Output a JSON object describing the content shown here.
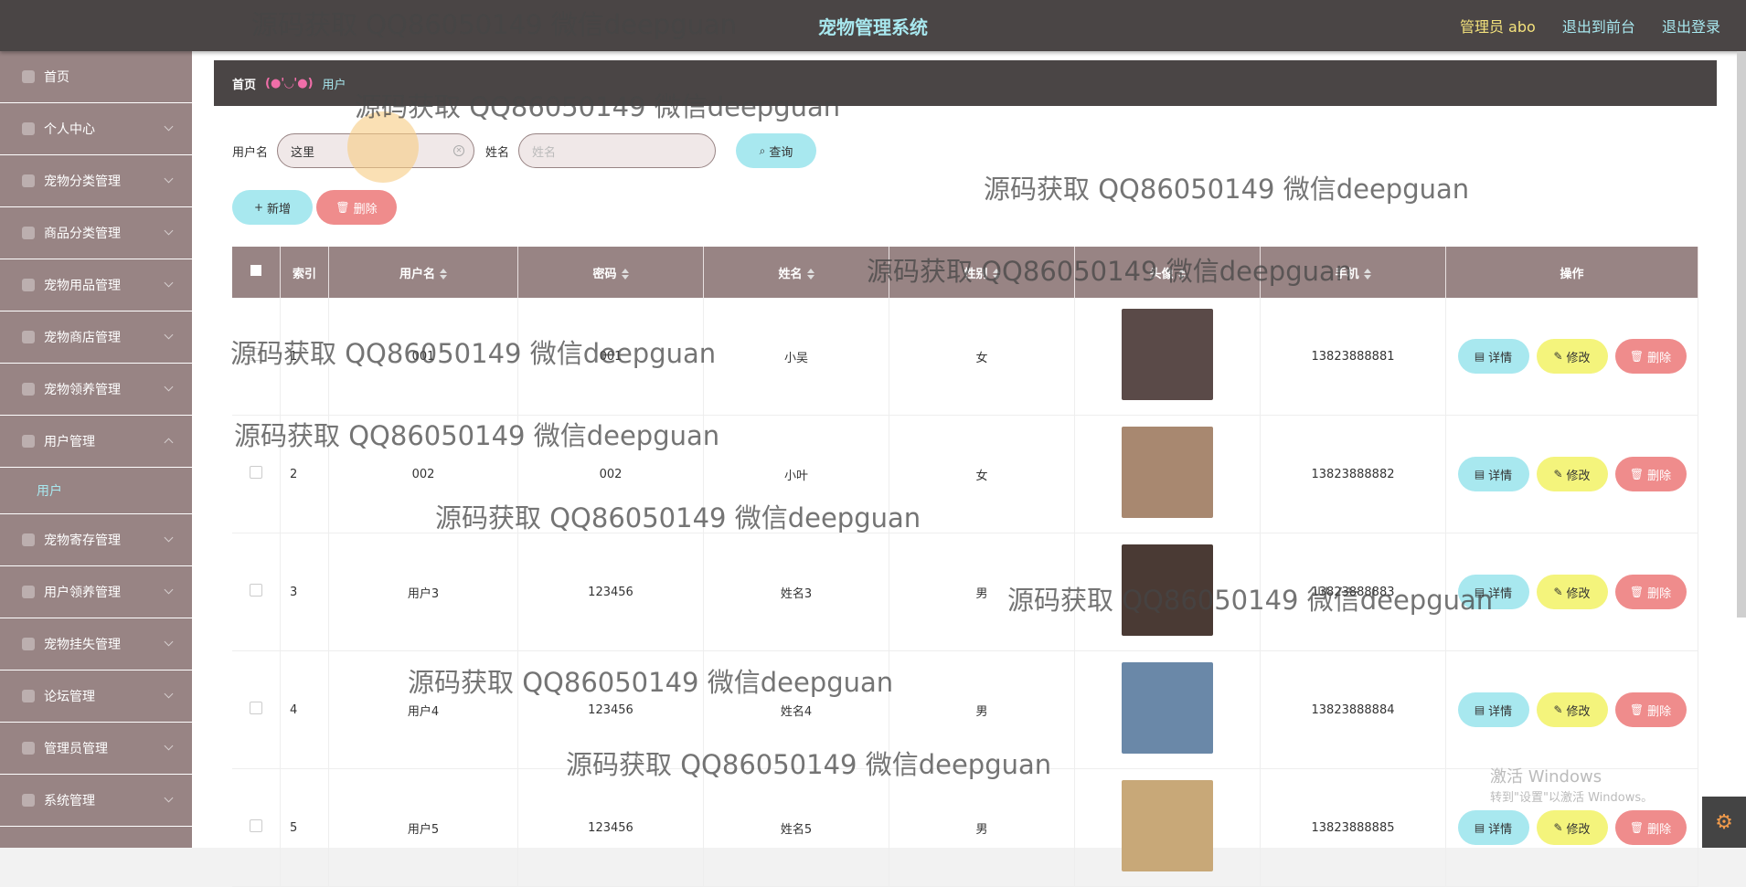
{
  "header": {
    "title": "宠物管理系统",
    "admin": "管理员 abo",
    "to_front": "退出到前台",
    "logout": "退出登录"
  },
  "sidebar": {
    "items": [
      {
        "label": "首页",
        "icon": "home-icon"
      },
      {
        "label": "个人中心",
        "icon": "user-icon"
      },
      {
        "label": "宠物分类管理",
        "icon": "list-icon"
      },
      {
        "label": "商品分类管理",
        "icon": "grid-icon"
      },
      {
        "label": "宠物用品管理",
        "icon": "list-icon"
      },
      {
        "label": "宠物商店管理",
        "icon": "list-icon"
      },
      {
        "label": "宠物领养管理",
        "icon": "list-icon"
      },
      {
        "label": "用户管理",
        "icon": "user-icon"
      },
      {
        "label": "宠物寄存管理",
        "icon": "flag-icon"
      },
      {
        "label": "用户领养管理",
        "icon": "circle-icon"
      },
      {
        "label": "宠物挂失管理",
        "icon": "user-icon"
      },
      {
        "label": "论坛管理",
        "icon": "list-icon"
      },
      {
        "label": "管理员管理",
        "icon": "user-icon"
      },
      {
        "label": "系统管理",
        "icon": "list-icon"
      }
    ],
    "sub_item": "用户"
  },
  "breadcrumb": {
    "home": "首页",
    "face": "(●'◡'●)",
    "current": "用户"
  },
  "search": {
    "username_label": "用户名",
    "username_value": "这里",
    "name_label": "姓名",
    "name_placeholder": "姓名",
    "query_button": "查询"
  },
  "actions": {
    "add": "新增",
    "delete": "删除"
  },
  "table": {
    "columns": [
      "索引",
      "用户名",
      "密码",
      "姓名",
      "性别",
      "头像",
      "手机",
      "操作"
    ],
    "rows": [
      {
        "index": "1",
        "username": "001",
        "password": "001",
        "name": "小吴",
        "gender": "女",
        "phone": "13823888881",
        "avatar_color": "#5a4a48"
      },
      {
        "index": "2",
        "username": "002",
        "password": "002",
        "name": "小叶",
        "gender": "女",
        "phone": "13823888882",
        "avatar_color": "#a88870"
      },
      {
        "index": "3",
        "username": "用户3",
        "password": "123456",
        "name": "姓名3",
        "gender": "男",
        "phone": "13823888883",
        "avatar_color": "#4a3a34"
      },
      {
        "index": "4",
        "username": "用户4",
        "password": "123456",
        "name": "姓名4",
        "gender": "男",
        "phone": "13823888884",
        "avatar_color": "#6a88a8"
      },
      {
        "index": "5",
        "username": "用户5",
        "password": "123456",
        "name": "姓名5",
        "gender": "男",
        "phone": "13823888885",
        "avatar_color": "#c8a878"
      }
    ],
    "ops": {
      "detail": "详情",
      "edit": "修改",
      "delete": "删除"
    }
  },
  "watermark": "源码获取 QQ86050149 微信deepguan",
  "windows_activation": {
    "line1": "激活 Windows",
    "line2": "转到\"设置\"以激活 Windows。"
  },
  "colors": {
    "accent_cyan": "#a8e8ef",
    "accent_red": "#ef8c8c",
    "accent_yellow": "#f4f47c",
    "sidebar": "#988484",
    "topbar": "#4a4545"
  }
}
